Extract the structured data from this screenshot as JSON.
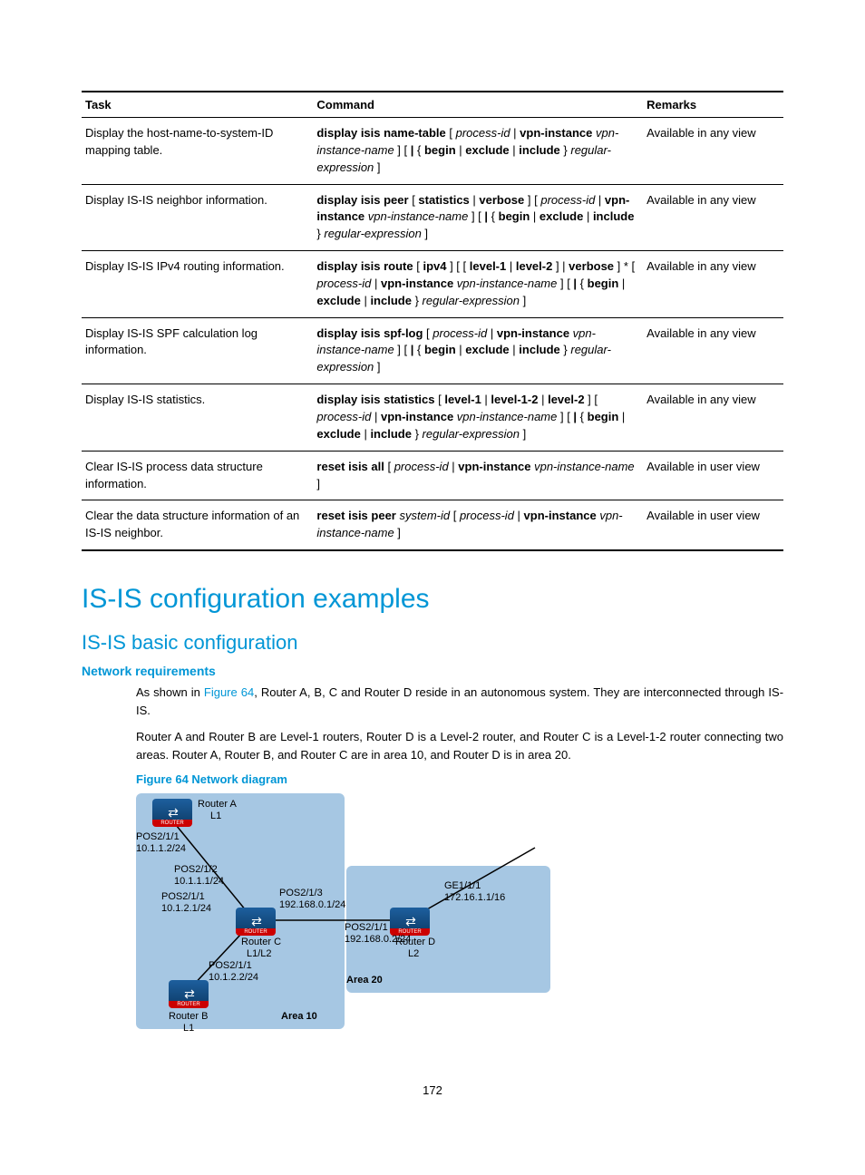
{
  "table": {
    "headers": {
      "task": "Task",
      "command": "Command",
      "remarks": "Remarks"
    },
    "rows": [
      {
        "task": "Display the host-name-to-system-ID mapping table.",
        "cmd_parts": [
          {
            "t": "display isis name-table",
            "c": "b"
          },
          {
            "t": " [ ",
            "c": ""
          },
          {
            "t": "process-id",
            "c": "i"
          },
          {
            "t": " | ",
            "c": ""
          },
          {
            "t": "vpn-instance",
            "c": "b"
          },
          {
            "t": " ",
            "c": ""
          },
          {
            "t": "vpn-instance-name",
            "c": "i"
          },
          {
            "t": " ] [ ",
            "c": ""
          },
          {
            "t": "|",
            "c": "b"
          },
          {
            "t": " { ",
            "c": ""
          },
          {
            "t": "begin",
            "c": "b"
          },
          {
            "t": " | ",
            "c": ""
          },
          {
            "t": "exclude",
            "c": "b"
          },
          {
            "t": " | ",
            "c": ""
          },
          {
            "t": "include",
            "c": "b"
          },
          {
            "t": " } ",
            "c": ""
          },
          {
            "t": "regular-expression",
            "c": "i"
          },
          {
            "t": " ]",
            "c": ""
          }
        ],
        "remarks": "Available in any view"
      },
      {
        "task": "Display IS-IS neighbor information.",
        "cmd_parts": [
          {
            "t": "display isis peer",
            "c": "b"
          },
          {
            "t": " [ ",
            "c": ""
          },
          {
            "t": "statistics",
            "c": "b"
          },
          {
            "t": " | ",
            "c": ""
          },
          {
            "t": "verbose",
            "c": "b"
          },
          {
            "t": " ] [ ",
            "c": ""
          },
          {
            "t": "process-id",
            "c": "i"
          },
          {
            "t": " | ",
            "c": ""
          },
          {
            "t": "vpn-instance",
            "c": "b"
          },
          {
            "t": " ",
            "c": ""
          },
          {
            "t": "vpn-instance-name",
            "c": "i"
          },
          {
            "t": " ] [ ",
            "c": ""
          },
          {
            "t": "|",
            "c": "b"
          },
          {
            "t": " { ",
            "c": ""
          },
          {
            "t": "begin",
            "c": "b"
          },
          {
            "t": " | ",
            "c": ""
          },
          {
            "t": "exclude",
            "c": "b"
          },
          {
            "t": " | ",
            "c": ""
          },
          {
            "t": "include",
            "c": "b"
          },
          {
            "t": " } ",
            "c": ""
          },
          {
            "t": "regular-expression",
            "c": "i"
          },
          {
            "t": " ]",
            "c": ""
          }
        ],
        "remarks": "Available in any view"
      },
      {
        "task": "Display IS-IS IPv4 routing information.",
        "cmd_parts": [
          {
            "t": "display isis route",
            "c": "b"
          },
          {
            "t": " [ ",
            "c": ""
          },
          {
            "t": "ipv4",
            "c": "b"
          },
          {
            "t": " ] [ [ ",
            "c": ""
          },
          {
            "t": "level-1",
            "c": "b"
          },
          {
            "t": " | ",
            "c": ""
          },
          {
            "t": "level-2",
            "c": "b"
          },
          {
            "t": " ] | ",
            "c": ""
          },
          {
            "t": "verbose",
            "c": "b"
          },
          {
            "t": " ] * [ ",
            "c": ""
          },
          {
            "t": "process-id",
            "c": "i"
          },
          {
            "t": " | ",
            "c": ""
          },
          {
            "t": "vpn-instance",
            "c": "b"
          },
          {
            "t": " ",
            "c": ""
          },
          {
            "t": "vpn-instance-name",
            "c": "i"
          },
          {
            "t": " ] [ ",
            "c": ""
          },
          {
            "t": "|",
            "c": "b"
          },
          {
            "t": " { ",
            "c": ""
          },
          {
            "t": "begin",
            "c": "b"
          },
          {
            "t": " | ",
            "c": ""
          },
          {
            "t": "exclude",
            "c": "b"
          },
          {
            "t": " | ",
            "c": ""
          },
          {
            "t": "include",
            "c": "b"
          },
          {
            "t": " } ",
            "c": ""
          },
          {
            "t": "regular-expression",
            "c": "i"
          },
          {
            "t": " ]",
            "c": ""
          }
        ],
        "remarks": "Available in any view"
      },
      {
        "task": "Display IS-IS SPF  calculation log information.",
        "cmd_parts": [
          {
            "t": "display isis spf-log",
            "c": "b"
          },
          {
            "t": " [ ",
            "c": ""
          },
          {
            "t": "process-id",
            "c": "i"
          },
          {
            "t": " | ",
            "c": ""
          },
          {
            "t": "vpn-instance",
            "c": "b"
          },
          {
            "t": " ",
            "c": ""
          },
          {
            "t": "vpn-instance-name",
            "c": "i"
          },
          {
            "t": " ] [ ",
            "c": ""
          },
          {
            "t": "|",
            "c": "b"
          },
          {
            "t": " { ",
            "c": ""
          },
          {
            "t": "begin",
            "c": "b"
          },
          {
            "t": " | ",
            "c": ""
          },
          {
            "t": "exclude",
            "c": "b"
          },
          {
            "t": " | ",
            "c": ""
          },
          {
            "t": "include",
            "c": "b"
          },
          {
            "t": " } ",
            "c": ""
          },
          {
            "t": "regular-expression",
            "c": "i"
          },
          {
            "t": " ]",
            "c": ""
          }
        ],
        "remarks": "Available in any view"
      },
      {
        "task": "Display IS-IS statistics.",
        "cmd_parts": [
          {
            "t": "display isis statistics",
            "c": "b"
          },
          {
            "t": " [ ",
            "c": ""
          },
          {
            "t": "level-1",
            "c": "b"
          },
          {
            "t": " | ",
            "c": ""
          },
          {
            "t": "level-1-2",
            "c": "b"
          },
          {
            "t": " | ",
            "c": ""
          },
          {
            "t": "level-2",
            "c": "b"
          },
          {
            "t": " ] [ ",
            "c": ""
          },
          {
            "t": "process-id",
            "c": "i"
          },
          {
            "t": " | ",
            "c": ""
          },
          {
            "t": "vpn-instance",
            "c": "b"
          },
          {
            "t": " ",
            "c": ""
          },
          {
            "t": "vpn-instance-name",
            "c": "i"
          },
          {
            "t": " ] [ ",
            "c": ""
          },
          {
            "t": "|",
            "c": "b"
          },
          {
            "t": " { ",
            "c": ""
          },
          {
            "t": "begin",
            "c": "b"
          },
          {
            "t": " | ",
            "c": ""
          },
          {
            "t": "exclude",
            "c": "b"
          },
          {
            "t": " | ",
            "c": ""
          },
          {
            "t": "include",
            "c": "b"
          },
          {
            "t": " } ",
            "c": ""
          },
          {
            "t": "regular-expression",
            "c": "i"
          },
          {
            "t": " ]",
            "c": ""
          }
        ],
        "remarks": "Available in any view"
      },
      {
        "task": "Clear IS-IS process data structure information.",
        "cmd_parts": [
          {
            "t": "reset isis all",
            "c": "b"
          },
          {
            "t": " [ ",
            "c": ""
          },
          {
            "t": "process-id",
            "c": "i"
          },
          {
            "t": " | ",
            "c": ""
          },
          {
            "t": "vpn-instance",
            "c": "b"
          },
          {
            "t": " ",
            "c": ""
          },
          {
            "t": "vpn-instance-name",
            "c": "i"
          },
          {
            "t": " ]",
            "c": ""
          }
        ],
        "remarks": "Available in user view"
      },
      {
        "task": "Clear the data structure information of an IS-IS neighbor.",
        "cmd_parts": [
          {
            "t": "reset isis peer",
            "c": "b"
          },
          {
            "t": " ",
            "c": ""
          },
          {
            "t": "system-id",
            "c": "i"
          },
          {
            "t": " [ ",
            "c": ""
          },
          {
            "t": "process-id",
            "c": "i"
          },
          {
            "t": " | ",
            "c": ""
          },
          {
            "t": "vpn-instance",
            "c": "b"
          },
          {
            "t": " ",
            "c": ""
          },
          {
            "t": "vpn-instance-name",
            "c": "i"
          },
          {
            "t": " ]",
            "c": ""
          }
        ],
        "remarks": "Available in user view"
      }
    ]
  },
  "headings": {
    "h1": "IS-IS configuration examples",
    "h2": "IS-IS basic configuration",
    "h3": "Network requirements"
  },
  "paragraphs": {
    "p1_a": "As shown in ",
    "p1_link": "Figure 64",
    "p1_b": ", Router A, B, C and Router D reside in an autonomous system. They are interconnected through IS-IS.",
    "p2": "Router A and Router B are Level-1 routers, Router D is a Level-2 router, and Router C is a Level-1-2 router connecting two areas. Router A, Router B, and Router C are in area 10, and Router D is in area 20."
  },
  "figure": {
    "caption": "Figure 64 Network diagram",
    "area10": "Area 10",
    "area20": "Area 20",
    "routerA": "Router A",
    "routerA_lvl": "L1",
    "routerB": "Router B",
    "routerB_lvl": "L1",
    "routerC": "Router C",
    "routerC_lvl": "L1/L2",
    "routerD": "Router D",
    "routerD_lvl": "L2",
    "ifA": "POS2/1/1",
    "ifA_ip": "10.1.1.2/24",
    "ifC1": "POS2/1/2",
    "ifC1_ip": "10.1.1.1/24",
    "ifC2": "POS2/1/1",
    "ifC2_ip": "10.1.2.1/24",
    "ifC3": "POS2/1/3",
    "ifC3_ip": "192.168.0.1/24",
    "ifB": "POS2/1/1",
    "ifB_ip": "10.1.2.2/24",
    "ifD1": "POS2/1/1",
    "ifD1_ip": "192.168.0.2/24",
    "ifD2": "GE1/1/1",
    "ifD2_ip": "172.16.1.1/16"
  },
  "pagenum": "172"
}
